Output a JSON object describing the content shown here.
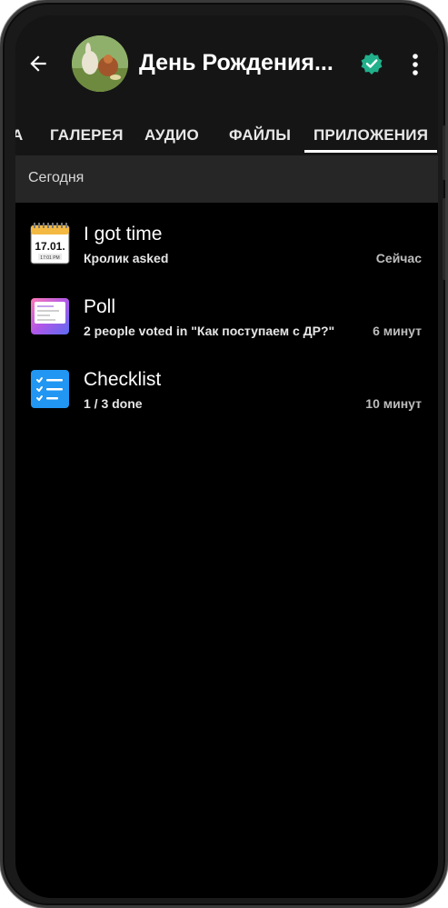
{
  "header": {
    "title": "День Рождения...",
    "back_icon": "arrow-left-icon",
    "verified_icon": "verified-check-icon",
    "more_icon": "more-vertical-icon"
  },
  "tabs": [
    {
      "label": "А"
    },
    {
      "label": "ГАЛЕРЕЯ"
    },
    {
      "label": "АУДИО"
    },
    {
      "label": "ФАЙЛЫ"
    },
    {
      "label": "ПРИЛОЖЕНИЯ",
      "selected": true
    }
  ],
  "section": {
    "title": "Сегодня"
  },
  "items": [
    {
      "title": "I got time",
      "subtitle": "Кролик asked",
      "time": "Сейчас",
      "icon": "calendar-icon",
      "icon_date": "17.01.",
      "icon_time": "17:01 PM"
    },
    {
      "title": "Poll",
      "subtitle": "2 people voted in \"Как поступаем с ДР?\"",
      "time": "6 минут",
      "icon": "poll-icon"
    },
    {
      "title": "Checklist",
      "subtitle": "1 / 3 done",
      "time": "10 минут",
      "icon": "checklist-icon"
    }
  ],
  "colors": {
    "background": "#000000",
    "header": "#151515",
    "section": "#262626",
    "verified": "#21b08b",
    "checklist": "#2196f3"
  }
}
